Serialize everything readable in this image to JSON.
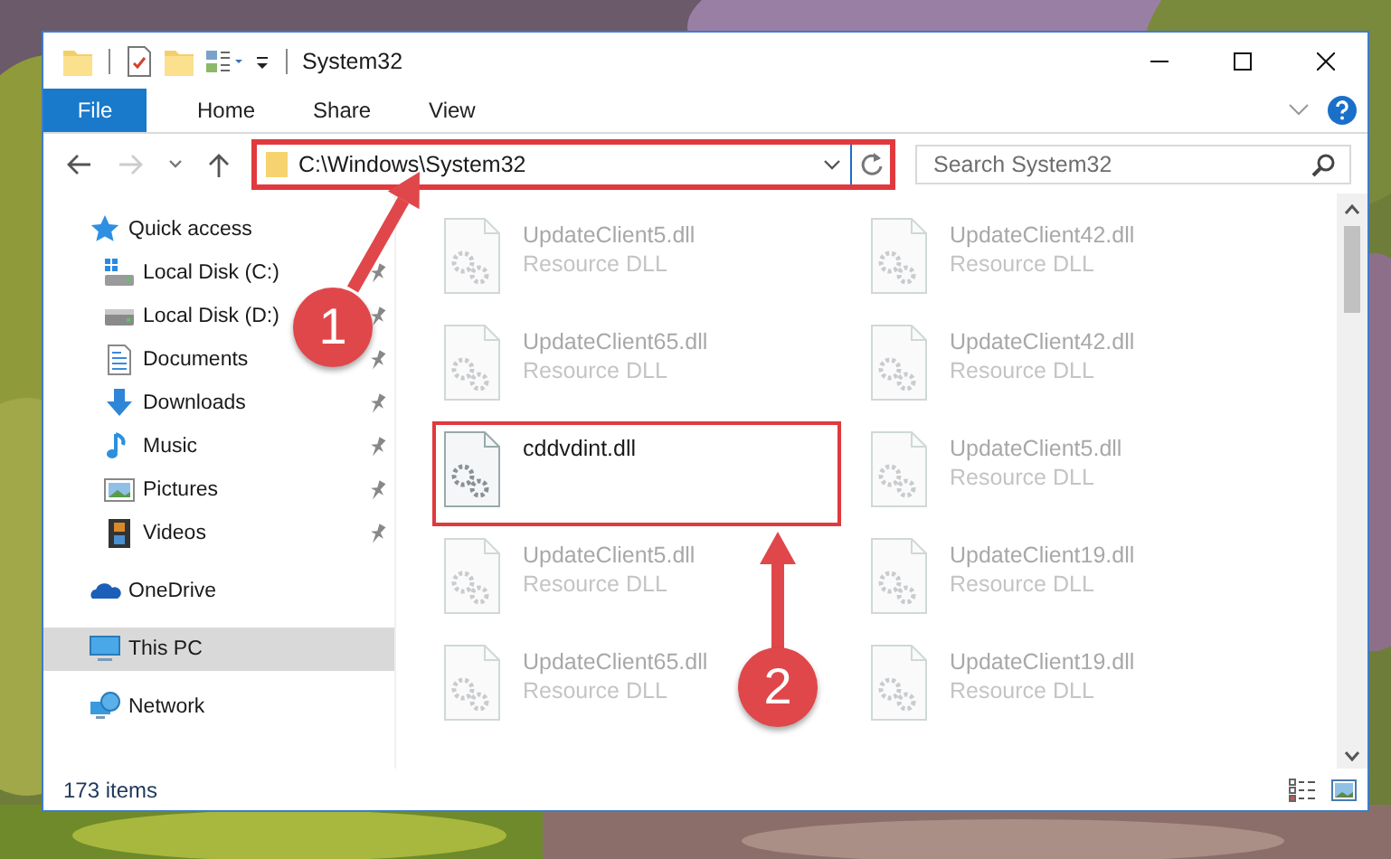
{
  "window": {
    "title": "System32"
  },
  "ribbon_tabs": [
    {
      "label": "File",
      "kind": "file_menu"
    },
    {
      "label": "Home",
      "kind": "tab"
    },
    {
      "label": "Share",
      "kind": "tab"
    },
    {
      "label": "View",
      "kind": "tab"
    }
  ],
  "navigation": {
    "address": "C:\\Windows\\System32",
    "address_highlighted": true,
    "search": {
      "placeholder": "Search System32"
    }
  },
  "sidebar": {
    "items": [
      {
        "label": "Quick access",
        "kind": "star",
        "selected": false,
        "children": [
          {
            "label": "Local Disk (C:)",
            "kind": "system_drive",
            "pinned": true,
            "selected": false
          },
          {
            "label": "Local Disk (D:)",
            "kind": "drive",
            "pinned": true,
            "selected": false
          },
          {
            "label": "Documents",
            "kind": "documents",
            "pinned": true,
            "selected": false
          },
          {
            "label": "Downloads",
            "kind": "downloads",
            "pinned": true,
            "selected": false
          },
          {
            "label": "Music",
            "kind": "music",
            "pinned": true,
            "selected": false
          },
          {
            "label": "Pictures",
            "kind": "pictures",
            "pinned": true,
            "selected": false
          },
          {
            "label": "Videos",
            "kind": "videos",
            "pinned": true,
            "selected": false
          }
        ]
      },
      {
        "label": "OneDrive",
        "kind": "cloud",
        "selected": false
      },
      {
        "label": "This PC",
        "kind": "computer",
        "selected": true
      },
      {
        "label": "Network",
        "kind": "network",
        "selected": false
      }
    ]
  },
  "files": [
    {
      "name": "UpdateClient5.dll",
      "type": "Resource DLL",
      "dimmed": true,
      "highlighted": false
    },
    {
      "name": "UpdateClient42.dll",
      "type": "Resource DLL",
      "dimmed": true,
      "highlighted": false
    },
    {
      "name": "UpdateClient65.dll",
      "type": "Resource DLL",
      "dimmed": true,
      "highlighted": false
    },
    {
      "name": "UpdateClient42.dll",
      "type": "Resource DLL",
      "dimmed": true,
      "highlighted": false
    },
    {
      "name": "cddvdint.dll",
      "dimmed": false,
      "highlighted": true
    },
    {
      "name": "UpdateClient5.dll",
      "type": "Resource DLL",
      "dimmed": true,
      "highlighted": false
    },
    {
      "name": "UpdateClient5.dll",
      "type": "Resource DLL",
      "dimmed": true,
      "highlighted": false
    },
    {
      "name": "UpdateClient19.dll",
      "type": "Resource DLL",
      "dimmed": true,
      "highlighted": false
    },
    {
      "name": "UpdateClient65.dll",
      "type": "Resource DLL",
      "dimmed": true,
      "highlighted": false
    },
    {
      "name": "UpdateClient19.dll",
      "type": "Resource DLL",
      "dimmed": true,
      "highlighted": false
    }
  ],
  "status_bar": {
    "item_count": "173 items"
  },
  "callouts": [
    {
      "number": "1"
    },
    {
      "number": "2"
    }
  ]
}
